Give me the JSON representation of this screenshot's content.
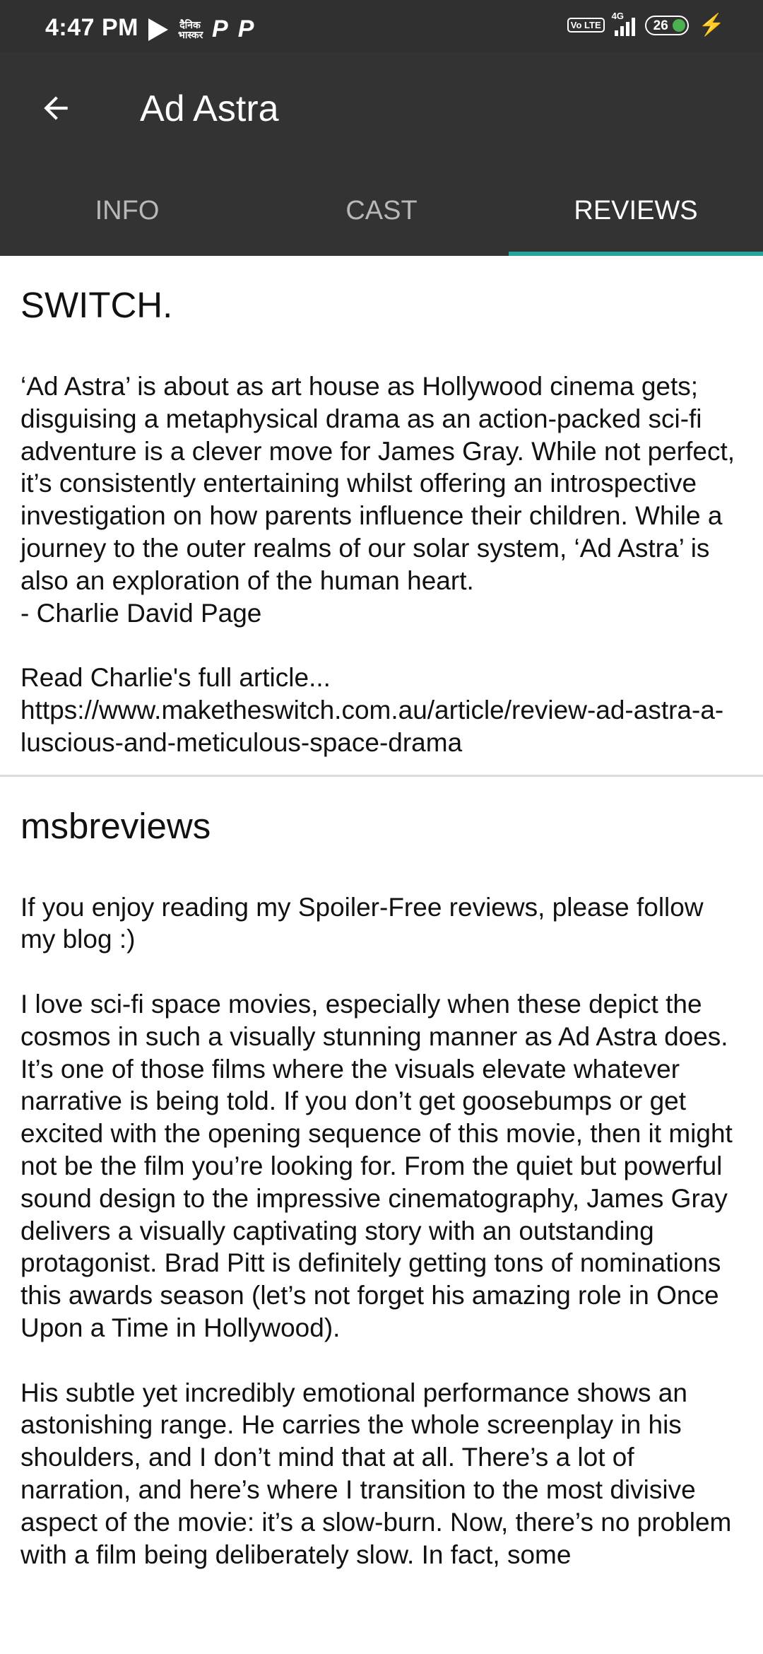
{
  "status_bar": {
    "time": "4:47 PM",
    "news_icon_text": "दैनिक भास्कर",
    "p_icon_1": "P",
    "p_icon_2": "P",
    "volte": "Vo LTE",
    "network": "4G",
    "battery": "26"
  },
  "header": {
    "title": "Ad Astra"
  },
  "tabs": [
    {
      "label": "INFO",
      "active": false
    },
    {
      "label": "CAST",
      "active": false
    },
    {
      "label": "REVIEWS",
      "active": true
    }
  ],
  "reviews": [
    {
      "author": "SWITCH.",
      "body": "‘Ad Astra’ is about as art house as Hollywood cinema gets; disguising a metaphysical drama as an action-packed sci-fi adventure is a clever move for James Gray. While not perfect, it’s consistently entertaining whilst offering an introspective investigation on how parents influence their children. While a journey to the outer realms of our solar system, ‘Ad Astra’ is also an exploration of the human heart.\n- Charlie David Page\n\nRead Charlie's full article...\nhttps://www.maketheswitch.com.au/article/review-ad-astra-a-luscious-and-meticulous-space-drama"
    },
    {
      "author": "msbreviews",
      "body": "If you enjoy reading my Spoiler-Free reviews, please follow my blog :)\n\nI love sci-fi space movies, especially when these depict the cosmos in such a visually stunning manner as Ad Astra does. It’s one of those films where the visuals elevate whatever narrative is being told. If you don’t get goosebumps or get excited with the opening sequence of this movie, then it might not be the film you’re looking for. From the quiet but powerful sound design to the impressive cinematography, James Gray delivers a visually captivating story with an outstanding protagonist. Brad Pitt is definitely getting tons of nominations this awards season (let’s not forget his amazing role in Once Upon a Time in Hollywood).\n\nHis subtle yet incredibly emotional performance shows an astonishing range. He carries the whole screenplay in his shoulders, and I don’t mind that at all. There’s a lot of narration, and here’s where I transition to the most divisive aspect of the movie: it’s a slow-burn. Now, there’s no problem with a film being deliberately slow. In fact, some"
    }
  ],
  "colors": {
    "app_bar": "#333333",
    "status_bar": "#303030",
    "tab_indicator": "#26a69a",
    "tab_inactive_text": "#b8b8b8",
    "text": "#111111"
  }
}
